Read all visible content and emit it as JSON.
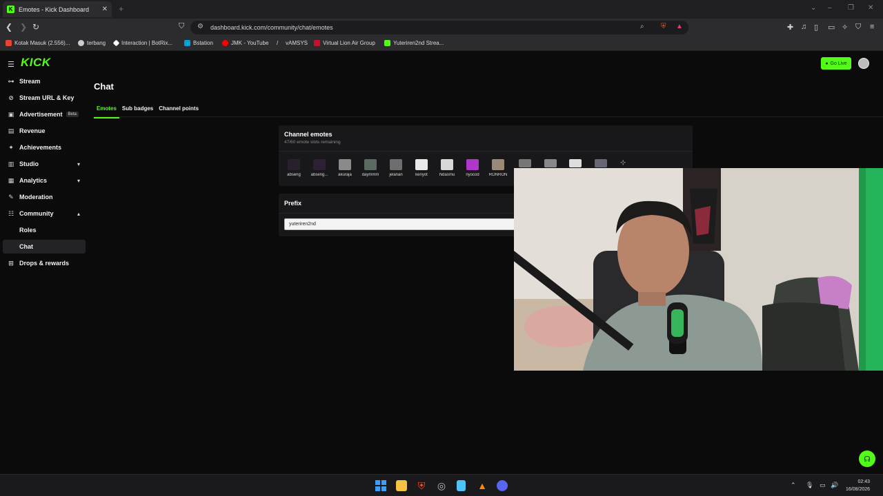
{
  "browser": {
    "tab_title": "Emotes - Kick Dashboard",
    "tab_favicon": "K",
    "url": "dashboard.kick.com/community/chat/emotes",
    "bookmarks": [
      {
        "label": "Kotak Masuk (2.556)...",
        "icon": "gmail-icon",
        "color": "#ea4335"
      },
      {
        "label": "terbang",
        "icon": "plane-icon",
        "color": "#cccccc"
      },
      {
        "label": "Interaction | BotRix...",
        "icon": "botrix-icon",
        "color": "#ffffff"
      },
      {
        "label": "Bstation",
        "icon": "bstation-icon",
        "color": "#00a1d6"
      },
      {
        "label": "JMK - YouTube",
        "icon": "youtube-icon",
        "color": "#ff0000"
      },
      {
        "label": "vAMSYS",
        "icon": "vamsys-icon",
        "color": "#dddddd"
      },
      {
        "label": "Virtual Lion Air Group",
        "icon": "lionair-icon",
        "color": "#c8102e"
      },
      {
        "label": "Yuteriren2nd Strea...",
        "icon": "kick-icon",
        "color": "#53fc18"
      }
    ]
  },
  "header": {
    "logo": "KICK",
    "go_live": "Go Live"
  },
  "sidebar": {
    "items": [
      {
        "label": "Stream",
        "icon": "stream-icon",
        "glyph": "⊶"
      },
      {
        "label": "Stream URL & Key",
        "icon": "link-icon",
        "glyph": "⊘"
      },
      {
        "label": "Advertisement",
        "icon": "ad-icon",
        "glyph": "▣",
        "badge": "Beta"
      },
      {
        "label": "Revenue",
        "icon": "revenue-icon",
        "glyph": "▤"
      },
      {
        "label": "Achievements",
        "icon": "trophy-icon",
        "glyph": "✦"
      },
      {
        "label": "Studio",
        "icon": "studio-icon",
        "glyph": "▥",
        "chevron": "down"
      },
      {
        "label": "Analytics",
        "icon": "analytics-icon",
        "glyph": "▦",
        "chevron": "down"
      },
      {
        "label": "Moderation",
        "icon": "hammer-icon",
        "glyph": "✎"
      },
      {
        "label": "Community",
        "icon": "community-icon",
        "glyph": "☷",
        "chevron": "up"
      },
      {
        "label": "Roles",
        "sub": true
      },
      {
        "label": "Chat",
        "sub": true,
        "active": true
      },
      {
        "label": "Drops & rewards",
        "icon": "gift-icon",
        "glyph": "⊞"
      }
    ]
  },
  "main": {
    "title": "Chat",
    "tabs": [
      {
        "label": "Emotes",
        "active": true
      },
      {
        "label": "Sub badges"
      },
      {
        "label": "Channel points"
      }
    ],
    "channel_emotes": {
      "title": "Channel emotes",
      "subtitle": "47/60 emote slots remaining",
      "emotes": [
        {
          "name": "abseng",
          "color": "#2a1f2d"
        },
        {
          "name": "abseng...",
          "color": "#2b2131"
        },
        {
          "name": "akuraja",
          "color": "#8a8a8a"
        },
        {
          "name": "daymmm",
          "color": "#5a6a60"
        },
        {
          "name": "jelanan",
          "color": "#6e6e6e"
        },
        {
          "name": "kenyot",
          "color": "#e8e8e8"
        },
        {
          "name": "Ndasmu",
          "color": "#d8d8d8"
        },
        {
          "name": "nyocod",
          "color": "#b038c8"
        },
        {
          "name": "RONRON",
          "color": "#9a8878"
        }
      ]
    },
    "prefix": {
      "title": "Prefix",
      "value": "yuteriren2nd"
    }
  },
  "taskbar": {
    "time": "02:43",
    "date": "16/08/2026",
    "apps": [
      {
        "icon": "windows-start-icon",
        "color": "#3aa0ff"
      },
      {
        "icon": "file-explorer-icon",
        "color": "#f5c342"
      },
      {
        "icon": "brave-icon",
        "color": "#fb542b"
      },
      {
        "icon": "chrome-icon",
        "color": "#9a9a9a"
      },
      {
        "icon": "notepad-icon",
        "color": "#4fc3f7"
      },
      {
        "icon": "vlc-icon",
        "color": "#ff8800"
      },
      {
        "icon": "discord-icon",
        "color": "#5865f2"
      }
    ]
  }
}
